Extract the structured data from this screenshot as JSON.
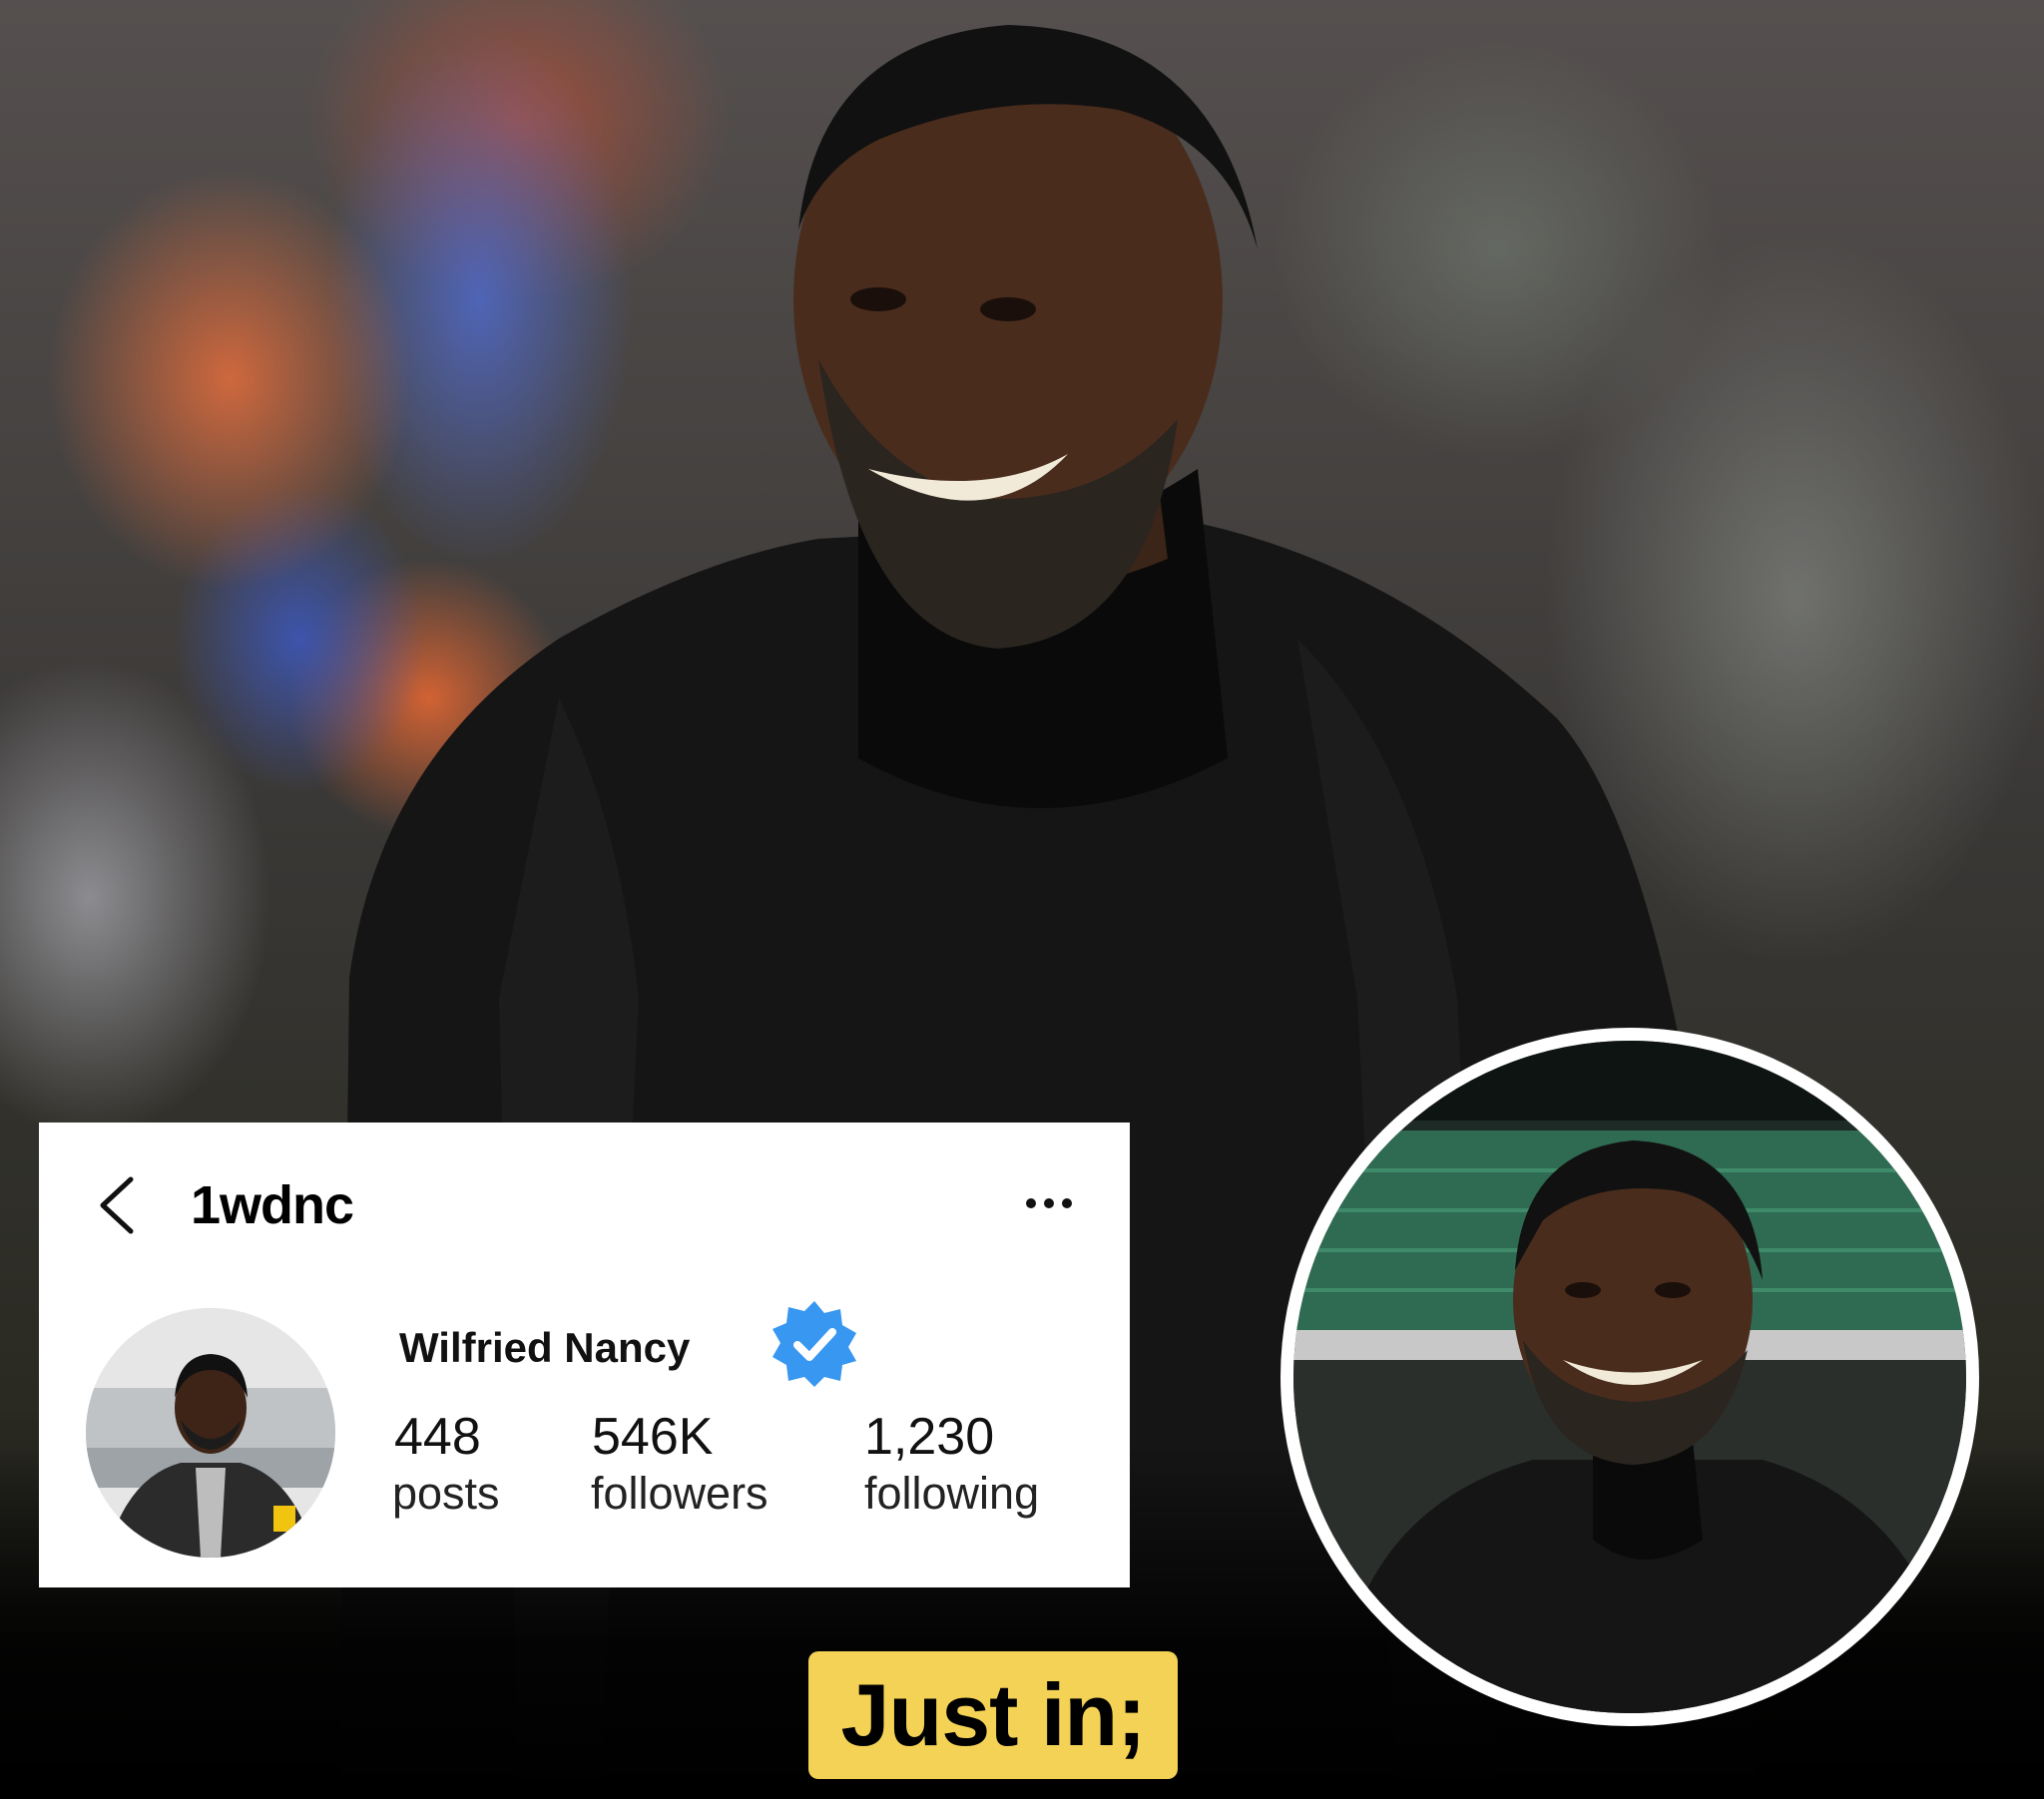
{
  "profile": {
    "username": "1wdnc",
    "display_name": "Wilfried Nancy",
    "verified": true,
    "stats": [
      {
        "value": "448",
        "label": "posts"
      },
      {
        "value": "546K",
        "label": "followers"
      },
      {
        "value": "1,230",
        "label": "following"
      }
    ],
    "icons": {
      "back": "chevron-left-icon",
      "more": "more-horizontal-icon",
      "verified": "verified-badge-icon"
    }
  },
  "tag": {
    "text": "Just in;"
  },
  "colors": {
    "tag_background": "#f3d256",
    "verified_blue": "#3897f0",
    "card_background": "#ffffff"
  }
}
